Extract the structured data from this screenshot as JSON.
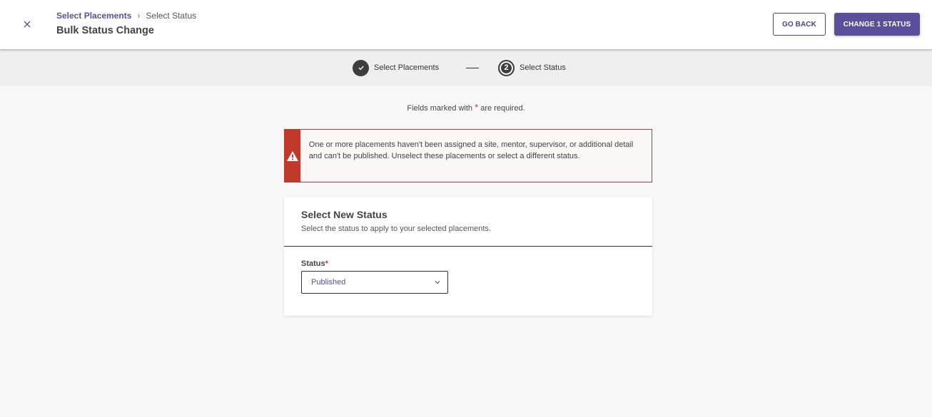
{
  "header": {
    "breadcrumb": {
      "parent": "Select Placements",
      "separator": "›",
      "current": "Select Status"
    },
    "title": "Bulk Status Change",
    "go_back_label": "GO BACK",
    "primary_label": "CHANGE 1 STATUS"
  },
  "stepper": {
    "steps": [
      {
        "label": "Select Placements",
        "state": "complete"
      },
      {
        "label": "Select Status",
        "number": "2",
        "state": "current"
      }
    ]
  },
  "form": {
    "required_note_prefix": "Fields marked with",
    "required_star": "*",
    "required_note_suffix": "are required."
  },
  "alert": {
    "message": "One or more placements haven't been assigned a site, mentor, supervisor, or additional detail and can't be published. Unselect these placements or select a different status."
  },
  "card": {
    "title": "Select New Status",
    "subtitle": "Select the status to apply to your selected placements.",
    "status_label": "Status",
    "status_value": "Published"
  },
  "colors": {
    "accent": "#5b4e9a",
    "error": "#c0392b",
    "step": "#3d3d3d"
  },
  "icons": {
    "close": "close-icon",
    "step_complete": "checkmark-icon",
    "alert": "warning-icon",
    "select": "chevron-down-icon"
  }
}
